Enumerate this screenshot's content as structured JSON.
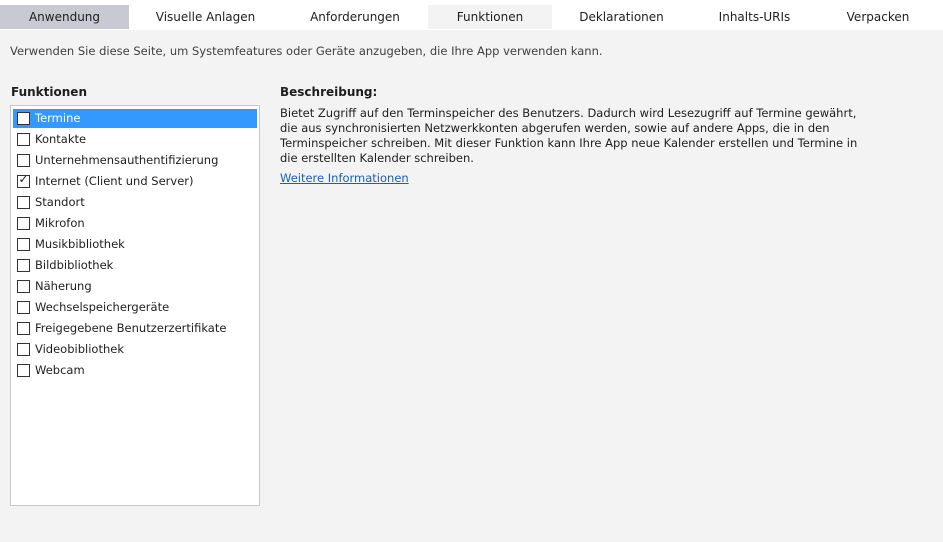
{
  "tabs": [
    {
      "label": "Anwendung"
    },
    {
      "label": "Visuelle Anlagen"
    },
    {
      "label": "Anforderungen"
    },
    {
      "label": "Funktionen"
    },
    {
      "label": "Deklarationen"
    },
    {
      "label": "Inhalts-URIs"
    },
    {
      "label": "Verpacken"
    }
  ],
  "active_tab": "Funktionen",
  "intro": "Verwenden Sie diese Seite, um Systemfeatures oder Geräte anzugeben, die Ihre App verwenden kann.",
  "capabilities": {
    "heading": "Funktionen",
    "selected_item": "Termine",
    "items": [
      {
        "label": "Termine",
        "checked": false
      },
      {
        "label": "Kontakte",
        "checked": false
      },
      {
        "label": "Unternehmensauthentifizierung",
        "checked": false
      },
      {
        "label": "Internet (Client und Server)",
        "checked": true
      },
      {
        "label": "Standort",
        "checked": false
      },
      {
        "label": "Mikrofon",
        "checked": false
      },
      {
        "label": "Musikbibliothek",
        "checked": false
      },
      {
        "label": "Bildbibliothek",
        "checked": false
      },
      {
        "label": "Näherung",
        "checked": false
      },
      {
        "label": "Wechselspeichergeräte",
        "checked": false
      },
      {
        "label": "Freigegebene Benutzerzertifikate",
        "checked": false
      },
      {
        "label": "Videobibliothek",
        "checked": false
      },
      {
        "label": "Webcam",
        "checked": false
      }
    ]
  },
  "description": {
    "heading": "Beschreibung:",
    "text": "Bietet Zugriff auf den Terminspeicher des Benutzers. Dadurch wird Lesezugriff auf Termine gewährt, die aus synchronisierten Netzwerkkonten abgerufen werden, sowie auf andere Apps, die in den Terminspeicher schreiben. Mit dieser Funktion kann Ihre App neue Kalender erstellen und Termine in die erstellten Kalender schreiben.",
    "link": "Weitere Informationen"
  },
  "icons": {
    "check": "check-icon"
  },
  "colors": {
    "selection": "#3399ff",
    "link": "#1a5fb4",
    "tab_shaded": "#c9c9d1",
    "background": "#f3f3f3"
  }
}
